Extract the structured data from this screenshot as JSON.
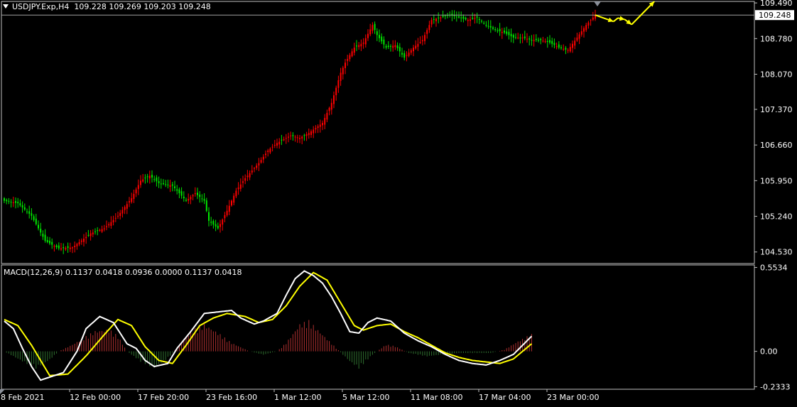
{
  "header": {
    "symbol": "USDJPY.Exp,H4",
    "ohlc": "109.228 109.269 109.203 109.248"
  },
  "macd_header": "MACD(12,26,9) 0.1137 0.0418 0.0936 0.0000 0.1137 0.0418",
  "colors": {
    "background": "#000000",
    "bull_candle": "#ff0000",
    "bear_candle": "#00e600",
    "grid_frame": "#c0c0c0",
    "macd_line": "#ffffff",
    "signal_line": "#ffff00",
    "hist_up": "#b03030",
    "hist_down": "#2f6f2f",
    "forecast_arrow": "#ffff00"
  },
  "chart_data": [
    {
      "type": "candlestick",
      "title": "USDJPY.Exp,H4",
      "timeframe": "H4",
      "last_price": 109.248,
      "last_price_label": "109.248",
      "ylim": [
        104.3,
        109.52
      ],
      "y_ticks": [
        109.49,
        108.78,
        108.07,
        107.37,
        106.66,
        105.95,
        105.24,
        104.53
      ],
      "y_tick_labels": [
        "109.490",
        "108.780",
        "108.070",
        "107.370",
        "106.660",
        "105.950",
        "105.240",
        "104.530"
      ],
      "x_tick_labels": [
        "8 Feb 2021",
        "12 Feb 00:00",
        "17 Feb 20:00",
        "23 Feb 16:00",
        "1 Mar 12:00",
        "5 Mar 12:00",
        "11 Mar 08:00",
        "17 Mar 04:00",
        "23 Mar 00:00"
      ],
      "close_path": [
        [
          0,
          105.55
        ],
        [
          6,
          105.5
        ],
        [
          12,
          105.25
        ],
        [
          18,
          104.75
        ],
        [
          24,
          104.6
        ],
        [
          30,
          104.62
        ],
        [
          38,
          104.9
        ],
        [
          44,
          105.0
        ],
        [
          50,
          105.25
        ],
        [
          56,
          105.6
        ],
        [
          60,
          105.95
        ],
        [
          64,
          106.05
        ],
        [
          68,
          105.9
        ],
        [
          74,
          105.85
        ],
        [
          80,
          105.55
        ],
        [
          84,
          105.7
        ],
        [
          88,
          105.55
        ],
        [
          90,
          105.15
        ],
        [
          94,
          105.0
        ],
        [
          98,
          105.35
        ],
        [
          102,
          105.75
        ],
        [
          106,
          106.0
        ],
        [
          112,
          106.3
        ],
        [
          116,
          106.55
        ],
        [
          120,
          106.7
        ],
        [
          126,
          106.85
        ],
        [
          130,
          106.8
        ],
        [
          134,
          106.9
        ],
        [
          140,
          107.1
        ],
        [
          144,
          107.5
        ],
        [
          148,
          108.1
        ],
        [
          150,
          108.3
        ],
        [
          154,
          108.6
        ],
        [
          158,
          108.7
        ],
        [
          162,
          109.05
        ],
        [
          164,
          108.85
        ],
        [
          168,
          108.6
        ],
        [
          172,
          108.65
        ],
        [
          176,
          108.4
        ],
        [
          180,
          108.6
        ],
        [
          184,
          108.75
        ],
        [
          188,
          109.15
        ],
        [
          192,
          109.2
        ],
        [
          196,
          109.25
        ],
        [
          200,
          109.2
        ],
        [
          204,
          109.15
        ],
        [
          208,
          109.2
        ],
        [
          212,
          109.05
        ],
        [
          216,
          108.95
        ],
        [
          220,
          108.9
        ],
        [
          224,
          108.8
        ],
        [
          228,
          108.8
        ],
        [
          232,
          108.75
        ],
        [
          236,
          108.75
        ],
        [
          240,
          108.7
        ],
        [
          244,
          108.6
        ],
        [
          248,
          108.55
        ],
        [
          252,
          108.8
        ],
        [
          256,
          109.05
        ],
        [
          260,
          109.25
        ]
      ],
      "forecast_path": [
        [
          260,
          109.248
        ],
        [
          268,
          109.12
        ],
        [
          270,
          109.19
        ],
        [
          273,
          109.16
        ],
        [
          276,
          109.06
        ],
        [
          286,
          109.52
        ]
      ]
    },
    {
      "type": "macd",
      "title": "MACD(12,26,9)",
      "parameters": [
        12,
        26,
        9
      ],
      "values": {
        "macd": 0.1137,
        "signal": 0.0418
      },
      "ylim": [
        -0.25,
        0.57
      ],
      "y_tick_labels": [
        "0.5534",
        "0.00",
        "-0.2333"
      ],
      "y_ticks": [
        0.5534,
        0.0,
        -0.2333
      ],
      "macd": [
        [
          0,
          0.2
        ],
        [
          4,
          0.15
        ],
        [
          8,
          0.02
        ],
        [
          12,
          -0.1
        ],
        [
          16,
          -0.19
        ],
        [
          20,
          -0.17
        ],
        [
          26,
          -0.14
        ],
        [
          32,
          0.0
        ],
        [
          36,
          0.15
        ],
        [
          42,
          0.23
        ],
        [
          48,
          0.19
        ],
        [
          54,
          0.05
        ],
        [
          58,
          0.02
        ],
        [
          62,
          -0.06
        ],
        [
          66,
          -0.1
        ],
        [
          72,
          -0.08
        ],
        [
          76,
          0.02
        ],
        [
          82,
          0.13
        ],
        [
          88,
          0.25
        ],
        [
          94,
          0.26
        ],
        [
          100,
          0.27
        ],
        [
          104,
          0.22
        ],
        [
          110,
          0.18
        ],
        [
          114,
          0.2
        ],
        [
          120,
          0.25
        ],
        [
          124,
          0.37
        ],
        [
          128,
          0.48
        ],
        [
          132,
          0.53
        ],
        [
          136,
          0.5
        ],
        [
          140,
          0.45
        ],
        [
          144,
          0.36
        ],
        [
          148,
          0.25
        ],
        [
          152,
          0.13
        ],
        [
          156,
          0.12
        ],
        [
          160,
          0.19
        ],
        [
          164,
          0.22
        ],
        [
          170,
          0.2
        ],
        [
          176,
          0.12
        ],
        [
          182,
          0.07
        ],
        [
          188,
          0.03
        ],
        [
          194,
          -0.02
        ],
        [
          200,
          -0.06
        ],
        [
          206,
          -0.08
        ],
        [
          212,
          -0.09
        ],
        [
          218,
          -0.06
        ],
        [
          224,
          -0.02
        ],
        [
          228,
          0.04
        ],
        [
          232,
          0.1
        ]
      ],
      "signal": [
        [
          0,
          0.21
        ],
        [
          6,
          0.17
        ],
        [
          12,
          0.04
        ],
        [
          16,
          -0.06
        ],
        [
          20,
          -0.16
        ],
        [
          28,
          -0.15
        ],
        [
          36,
          -0.03
        ],
        [
          44,
          0.11
        ],
        [
          50,
          0.21
        ],
        [
          56,
          0.17
        ],
        [
          62,
          0.03
        ],
        [
          68,
          -0.06
        ],
        [
          74,
          -0.08
        ],
        [
          80,
          0.04
        ],
        [
          86,
          0.17
        ],
        [
          92,
          0.22
        ],
        [
          98,
          0.25
        ],
        [
          106,
          0.23
        ],
        [
          112,
          0.19
        ],
        [
          118,
          0.21
        ],
        [
          124,
          0.3
        ],
        [
          130,
          0.43
        ],
        [
          136,
          0.52
        ],
        [
          142,
          0.47
        ],
        [
          148,
          0.32
        ],
        [
          154,
          0.17
        ],
        [
          158,
          0.14
        ],
        [
          164,
          0.17
        ],
        [
          170,
          0.18
        ],
        [
          176,
          0.13
        ],
        [
          182,
          0.09
        ],
        [
          188,
          0.04
        ],
        [
          194,
          -0.01
        ],
        [
          200,
          -0.04
        ],
        [
          206,
          -0.06
        ],
        [
          212,
          -0.07
        ],
        [
          218,
          -0.08
        ],
        [
          224,
          -0.05
        ],
        [
          228,
          0.0
        ],
        [
          232,
          0.05
        ]
      ],
      "histogram_path": [
        [
          0,
          0.0
        ],
        [
          8,
          -0.06
        ],
        [
          14,
          -0.1
        ],
        [
          20,
          -0.05
        ],
        [
          24,
          0.0
        ],
        [
          30,
          0.04
        ],
        [
          40,
          0.12
        ],
        [
          46,
          0.13
        ],
        [
          50,
          0.09
        ],
        [
          54,
          0.0
        ],
        [
          60,
          -0.06
        ],
        [
          66,
          -0.1
        ],
        [
          72,
          -0.04
        ],
        [
          76,
          0.02
        ],
        [
          82,
          0.12
        ],
        [
          88,
          0.16
        ],
        [
          94,
          0.11
        ],
        [
          100,
          0.05
        ],
        [
          108,
          0.0
        ],
        [
          114,
          -0.02
        ],
        [
          120,
          0.0
        ],
        [
          124,
          0.05
        ],
        [
          130,
          0.16
        ],
        [
          134,
          0.18
        ],
        [
          140,
          0.1
        ],
        [
          146,
          0.02
        ],
        [
          152,
          -0.06
        ],
        [
          156,
          -0.1
        ],
        [
          162,
          -0.02
        ],
        [
          168,
          0.04
        ],
        [
          172,
          0.03
        ],
        [
          178,
          -0.01
        ],
        [
          186,
          -0.03
        ],
        [
          192,
          -0.02
        ],
        [
          200,
          -0.01
        ],
        [
          208,
          -0.01
        ],
        [
          214,
          -0.01
        ],
        [
          220,
          0.01
        ],
        [
          226,
          0.06
        ],
        [
          232,
          0.1
        ]
      ]
    }
  ]
}
